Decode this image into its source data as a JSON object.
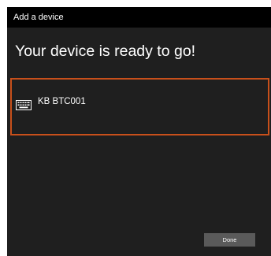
{
  "window": {
    "title": "Add a device"
  },
  "main": {
    "heading": "Your device is ready to go!"
  },
  "devices": [
    {
      "name": "KB BTC001",
      "icon": "keyboard-icon",
      "selected": true
    }
  ],
  "footer": {
    "done_label": "Done"
  },
  "colors": {
    "background": "#1f1f1f",
    "titlebar": "#000000",
    "accent_border": "#c8501b",
    "button": "#5a5a5a",
    "text": "#ffffff"
  }
}
